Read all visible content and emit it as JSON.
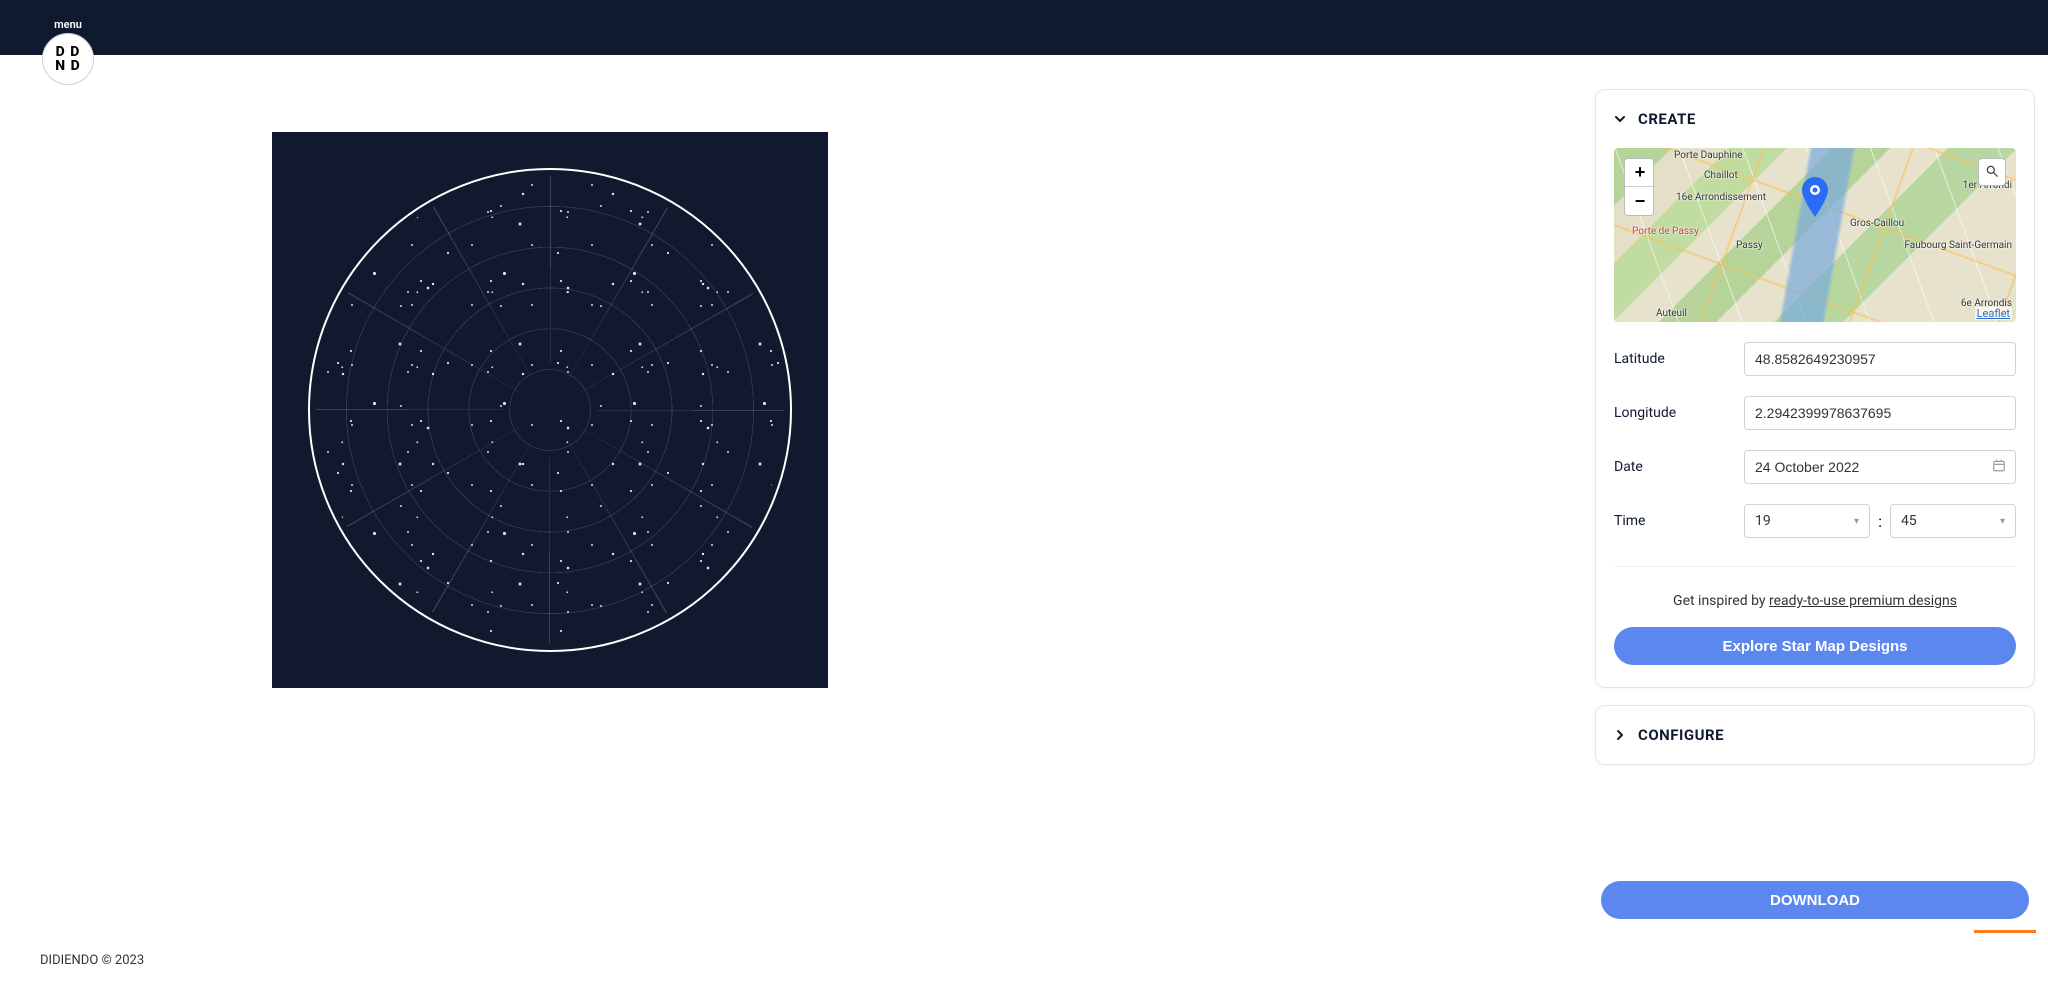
{
  "menu": {
    "label": "menu",
    "logo_top": "D D",
    "logo_bottom": "N D"
  },
  "panels": {
    "create": {
      "title": "CREATE",
      "expanded": true
    },
    "configure": {
      "title": "CONFIGURE",
      "expanded": false
    }
  },
  "map": {
    "zoom_in": "+",
    "zoom_out": "−",
    "attribution": "Leaflet",
    "labels": {
      "porte_dauphine": "Porte Dauphine",
      "chaillot": "Chaillot",
      "arr16": "16e Arrondissement",
      "porte_passy": "Porte de Passy",
      "passy": "Passy",
      "auteuil": "Auteuil",
      "gros_caillou": "Gros-Caillou",
      "arr1": "1er Arrondi",
      "fsg": "Faubourg Saint-Germain",
      "arr6": "6e Arrondis"
    }
  },
  "form": {
    "latitude": {
      "label": "Latitude",
      "value": "48.8582649230957"
    },
    "longitude": {
      "label": "Longitude",
      "value": "2.2942399978637695"
    },
    "date": {
      "label": "Date",
      "value": "24 October 2022"
    },
    "time": {
      "label": "Time",
      "hour": "19",
      "minute": "45",
      "sep": ":"
    }
  },
  "inspire": {
    "prefix": "Get inspired by ",
    "link": "ready-to-use premium designs"
  },
  "buttons": {
    "explore": "Explore Star Map Designs",
    "download": "DOWNLOAD"
  },
  "footer": {
    "copyright": "DIDIENDO © 2023"
  }
}
